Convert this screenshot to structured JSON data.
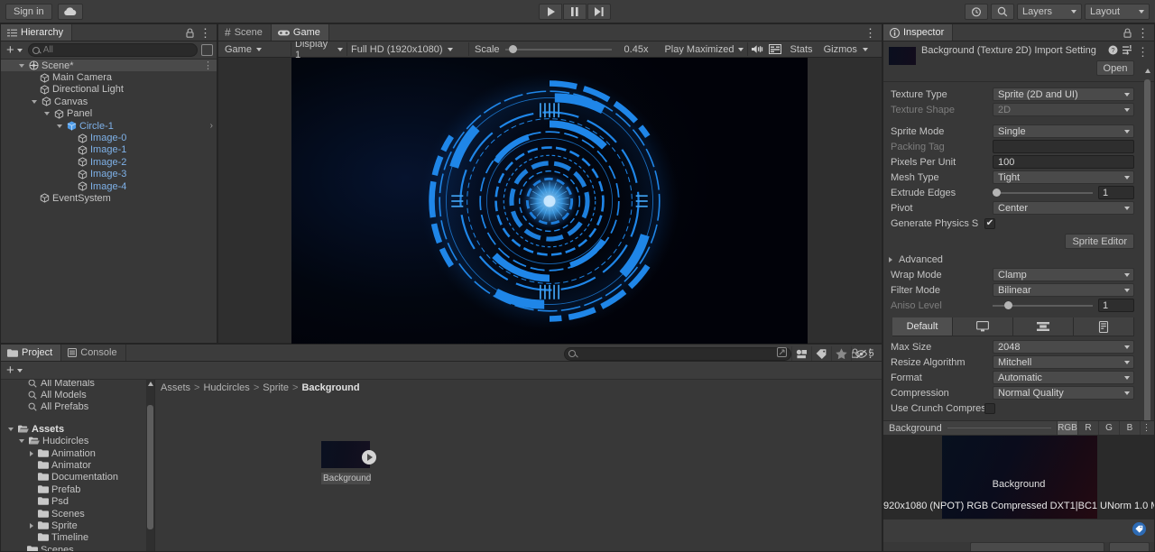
{
  "toolbar": {
    "signin_label": "Sign in",
    "cloud_icon": "cloud-icon",
    "play_icon": "play-icon",
    "pause_icon": "pause-icon",
    "step_icon": "step-icon",
    "history_icon": "undo-history-icon",
    "search_icon": "search-icon",
    "layers_label": "Layers",
    "layout_label": "Layout"
  },
  "hierarchy": {
    "tab_label": "Hierarchy",
    "lock_icon": "lock-icon",
    "menu_icon": "kebab-menu-icon",
    "add_label": "+",
    "search_placeholder": "All",
    "items": [
      {
        "label": "Scene*",
        "depth": 0,
        "expander": "down",
        "icon": "unity-scene-icon",
        "selected": true,
        "menu": true
      },
      {
        "label": "Main Camera",
        "depth": 1,
        "expander": "none",
        "icon": "gameobject-icon",
        "selected": false
      },
      {
        "label": "Directional Light",
        "depth": 1,
        "expander": "none",
        "icon": "gameobject-icon",
        "selected": false
      },
      {
        "label": "Canvas",
        "depth": 1,
        "expander": "down",
        "icon": "gameobject-icon",
        "selected": false
      },
      {
        "label": "Panel",
        "depth": 2,
        "expander": "down",
        "icon": "gameobject-icon",
        "selected": false
      },
      {
        "label": "Circle-1",
        "depth": 3,
        "expander": "down",
        "icon": "prefab-icon",
        "selected": false,
        "blue": true,
        "chevron": true
      },
      {
        "label": "Image-0",
        "depth": 4,
        "expander": "none",
        "icon": "gameobject-icon",
        "selected": false,
        "blue": true
      },
      {
        "label": "Image-1",
        "depth": 4,
        "expander": "none",
        "icon": "gameobject-icon",
        "selected": false,
        "blue": true
      },
      {
        "label": "Image-2",
        "depth": 4,
        "expander": "none",
        "icon": "gameobject-icon",
        "selected": false,
        "blue": true
      },
      {
        "label": "Image-3",
        "depth": 4,
        "expander": "none",
        "icon": "gameobject-icon",
        "selected": false,
        "blue": true
      },
      {
        "label": "Image-4",
        "depth": 4,
        "expander": "none",
        "icon": "gameobject-icon",
        "selected": false,
        "blue": true
      },
      {
        "label": "EventSystem",
        "depth": 1,
        "expander": "none",
        "icon": "gameobject-icon",
        "selected": false
      }
    ]
  },
  "gameview": {
    "tabs": [
      {
        "label": "Scene",
        "icon": "scene-grid-icon",
        "active": false
      },
      {
        "label": "Game",
        "icon": "gamepad-icon",
        "active": true
      }
    ],
    "menu_icon": "kebab-menu-icon",
    "target_display_label": "Game",
    "display_label": "Display 1",
    "resolution_label": "Full HD (1920x1080)",
    "scale_label": "Scale",
    "scale_value": "0.45x",
    "play_mode_label": "Play Maximized",
    "mute_icon": "mute-audio-icon",
    "stats_toggle_icon": "render-stats-icon",
    "stats_label": "Stats",
    "gizmos_label": "Gizmos"
  },
  "project": {
    "tabs": [
      {
        "label": "Project",
        "icon": "folder-icon",
        "active": true
      },
      {
        "label": "Console",
        "icon": "console-icon",
        "active": false
      }
    ],
    "lock_icon": "lock-icon",
    "menu_icon": "kebab-menu-icon",
    "add_label": "+",
    "search_placeholder": "",
    "search_icon": "search-icon",
    "filter_icons": [
      "filter-by-type-icon",
      "filter-by-label-icon",
      "favorites-star-icon",
      "hidden-packages-icon"
    ],
    "hidden_packages_count": "5",
    "tree": [
      {
        "label": "All Materials",
        "depth": 1,
        "expander": "none",
        "icon": "search-small-icon",
        "clipped": true
      },
      {
        "label": "All Models",
        "depth": 1,
        "expander": "none",
        "icon": "search-small-icon"
      },
      {
        "label": "All Prefabs",
        "depth": 1,
        "expander": "none",
        "icon": "search-small-icon"
      },
      {
        "label": "",
        "depth": 0,
        "expander": "none",
        "icon": "spacer",
        "spacer": true
      },
      {
        "label": "Assets",
        "depth": 0,
        "expander": "down",
        "icon": "folder-open-icon",
        "bold": true
      },
      {
        "label": "Hudcircles",
        "depth": 1,
        "expander": "down",
        "icon": "folder-open-icon"
      },
      {
        "label": "Animation",
        "depth": 2,
        "expander": "right",
        "icon": "folder-icon"
      },
      {
        "label": "Animator",
        "depth": 2,
        "expander": "none",
        "icon": "folder-icon"
      },
      {
        "label": "Documentation",
        "depth": 2,
        "expander": "none",
        "icon": "folder-icon"
      },
      {
        "label": "Prefab",
        "depth": 2,
        "expander": "none",
        "icon": "folder-icon"
      },
      {
        "label": "Psd",
        "depth": 2,
        "expander": "none",
        "icon": "folder-icon"
      },
      {
        "label": "Scenes",
        "depth": 2,
        "expander": "none",
        "icon": "folder-icon"
      },
      {
        "label": "Sprite",
        "depth": 2,
        "expander": "right",
        "icon": "folder-icon"
      },
      {
        "label": "Timeline",
        "depth": 2,
        "expander": "none",
        "icon": "folder-icon"
      },
      {
        "label": "Scenes",
        "depth": 1,
        "expander": "none",
        "icon": "folder-icon"
      }
    ],
    "breadcrumb": [
      "Assets",
      "Hudcircles",
      "Sprite",
      "Background"
    ],
    "asset": {
      "name": "Background",
      "play_icon": "play-preview-icon"
    }
  },
  "inspector": {
    "tab_label": "Inspector",
    "tab_icon": "info-icon",
    "lock_icon": "lock-icon",
    "menu_icon": "kebab-menu-icon",
    "title": "Background (Texture 2D) Import Setting",
    "help_icon": "help-icon",
    "preset_icon": "preset-icon",
    "more_icon": "kebab-menu-icon",
    "open_label": "Open",
    "fields": [
      {
        "label": "Texture Type",
        "value": "Sprite (2D and UI)",
        "kind": "dropdown"
      },
      {
        "label": "Texture Shape",
        "value": "2D",
        "kind": "dropdown",
        "disabled": true
      },
      {
        "label": "",
        "value": "",
        "kind": "gap"
      },
      {
        "label": "Sprite Mode",
        "value": "Single",
        "kind": "dropdown"
      },
      {
        "label": "Packing Tag",
        "value": "",
        "kind": "text",
        "disabled": true
      },
      {
        "label": "Pixels Per Unit",
        "value": "100",
        "kind": "text"
      },
      {
        "label": "Mesh Type",
        "value": "Tight",
        "kind": "dropdown"
      },
      {
        "label": "Extrude Edges",
        "value": "1",
        "kind": "slider",
        "fill": 0
      },
      {
        "label": "Pivot",
        "value": "Center",
        "kind": "dropdown"
      },
      {
        "label": "Generate Physics S",
        "value": "✔",
        "kind": "checkbox"
      }
    ],
    "sprite_editor_label": "Sprite Editor",
    "advanced_label": "Advanced",
    "advanced_fields": [
      {
        "label": "Wrap Mode",
        "value": "Clamp",
        "kind": "dropdown"
      },
      {
        "label": "Filter Mode",
        "value": "Bilinear",
        "kind": "dropdown"
      },
      {
        "label": "Aniso Level",
        "value": "1",
        "kind": "slider",
        "disabled": true,
        "fill": 12
      }
    ],
    "platform_tabs": [
      {
        "label": "Default",
        "icon": "",
        "active": true
      },
      {
        "label": "",
        "icon": "standalone-monitor-icon",
        "active": false
      },
      {
        "label": "",
        "icon": "android-settings-icon",
        "active": false
      },
      {
        "label": "",
        "icon": "webgl-storage-icon",
        "active": false
      }
    ],
    "platform_fields": [
      {
        "label": "Max Size",
        "value": "2048",
        "kind": "dropdown"
      },
      {
        "label": "Resize Algorithm",
        "value": "Mitchell",
        "kind": "dropdown"
      },
      {
        "label": "Format",
        "value": "Automatic",
        "kind": "dropdown"
      },
      {
        "label": "Compression",
        "value": "Normal Quality",
        "kind": "dropdown"
      },
      {
        "label": "Use Crunch Compress",
        "value": "",
        "kind": "checkbox-off"
      }
    ],
    "preview": {
      "title": "Background",
      "channels": [
        "RGB",
        "R",
        "G",
        "B"
      ],
      "active_channel": "RGB",
      "menu_icon": "kebab-menu-icon",
      "image_label": "Background",
      "info": "920x1080 (NPOT)  RGB Compressed DXT1|BC1 UNorm   1.0 M",
      "tag_icon": "label-tag-icon"
    }
  },
  "colors": {
    "panel_bg": "#383838",
    "header_bg": "#3c3c3c",
    "selection": "#4a4a4a",
    "accent_blue": "#7eb1e8",
    "hud_blue": "#1f7ce0",
    "tag_badge": "#2d6bb5"
  }
}
